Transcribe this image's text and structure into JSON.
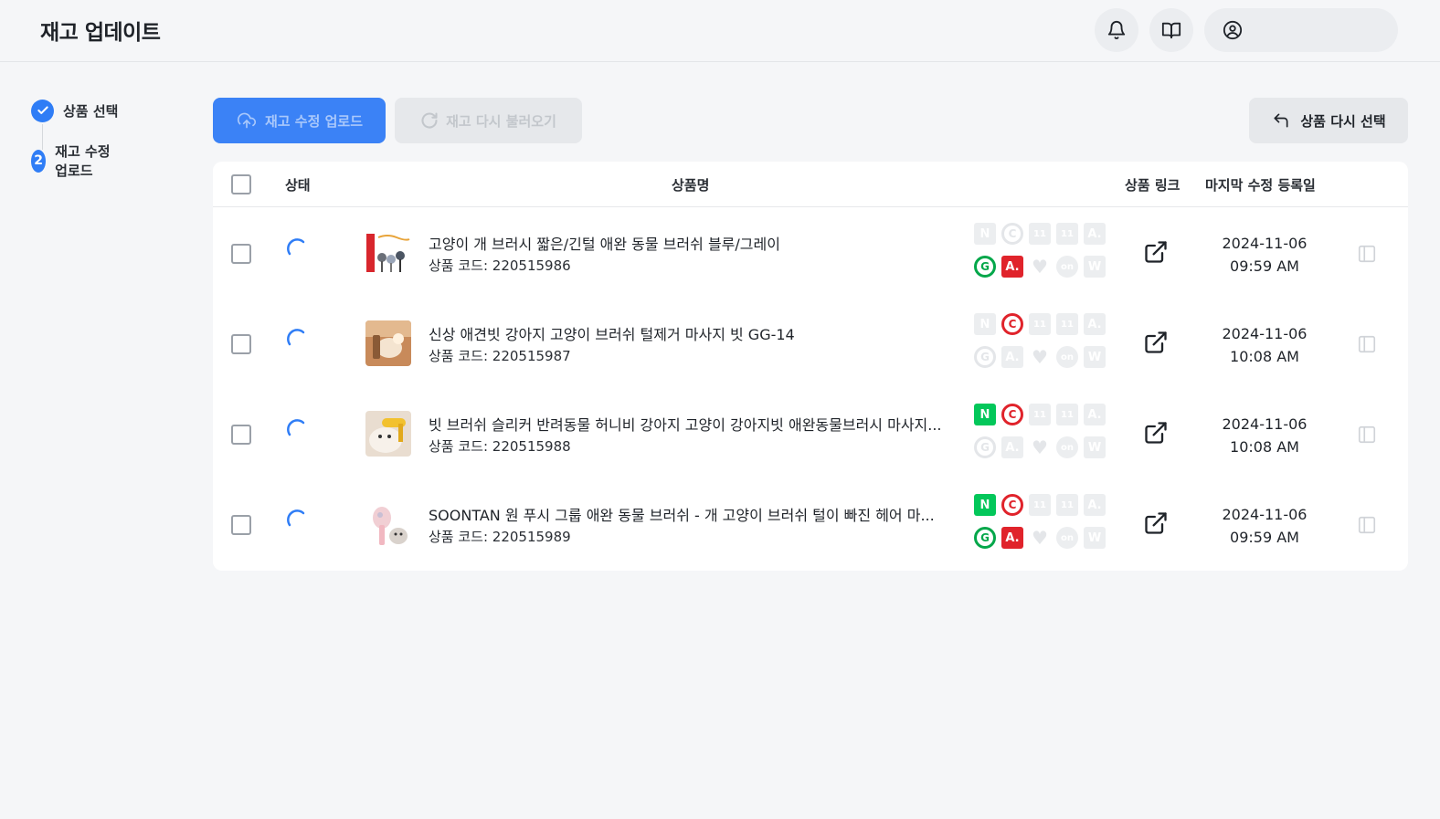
{
  "header": {
    "title": "재고 업데이트",
    "icons": [
      "bell-icon",
      "book-icon",
      "user-circle-icon"
    ]
  },
  "steps": [
    {
      "marker": "check",
      "label": "상품 선택"
    },
    {
      "marker": "2",
      "label": "재고 수정 업로드"
    }
  ],
  "toolbar": {
    "upload_label": "재고 수정 업로드",
    "reload_label": "재고 다시 불러오기",
    "reselect_label": "상품 다시 선택"
  },
  "table": {
    "headers": {
      "status": "상태",
      "name": "상품명",
      "link": "상품 링크",
      "date": "마지막 수정 등록일"
    },
    "rows": [
      {
        "name": "고양이 개 브러시 짧은/긴털 애완 동물 브러쉬 블루/그레이",
        "code": "상품 코드: 220515986",
        "date": "2024-11-06",
        "time": "09:59 AM",
        "channels": {
          "N": false,
          "C": false,
          "11_1": false,
          "11_2": false,
          "A_top": false,
          "G": true,
          "A": true,
          "heart": false,
          "on": false,
          "W": false
        }
      },
      {
        "name": "신상 애견빗 강아지 고양이 브러쉬 털제거 마사지 빗 GG-14",
        "code": "상품 코드: 220515987",
        "date": "2024-11-06",
        "time": "10:08 AM",
        "channels": {
          "N": false,
          "C": true,
          "11_1": false,
          "11_2": false,
          "A_top": false,
          "G": false,
          "A": false,
          "heart": false,
          "on": false,
          "W": false
        }
      },
      {
        "name": "빗 브러쉬 슬리커 반려동물 허니비 강아지 고양이 강아지빗 애완동물브러시 마사지...",
        "code": "상품 코드: 220515988",
        "date": "2024-11-06",
        "time": "10:08 AM",
        "channels": {
          "N": true,
          "C": true,
          "11_1": false,
          "11_2": false,
          "A_top": false,
          "G": false,
          "A": false,
          "heart": false,
          "on": false,
          "W": false
        }
      },
      {
        "name": "SOONTAN 원 푸시 그룹 애완 동물 브러쉬 - 개 고양이 브러쉬 털이 빠진 헤어 마...",
        "code": "상품 코드: 220515989",
        "date": "2024-11-06",
        "time": "09:59 AM",
        "channels": {
          "N": true,
          "C": true,
          "11_1": false,
          "11_2": false,
          "A_top": false,
          "G": true,
          "A": true,
          "heart": false,
          "on": false,
          "W": false
        }
      }
    ]
  },
  "badge_letters": {
    "N": "N",
    "C": "C",
    "11": "11",
    "A": "A.",
    "G": "G",
    "on": "on",
    "W": "W"
  },
  "colors": {
    "accent": "#3b82f6",
    "naver": "#03c75a",
    "red": "#e0232b",
    "green": "#03a74a",
    "disabled": "#eceef0"
  }
}
